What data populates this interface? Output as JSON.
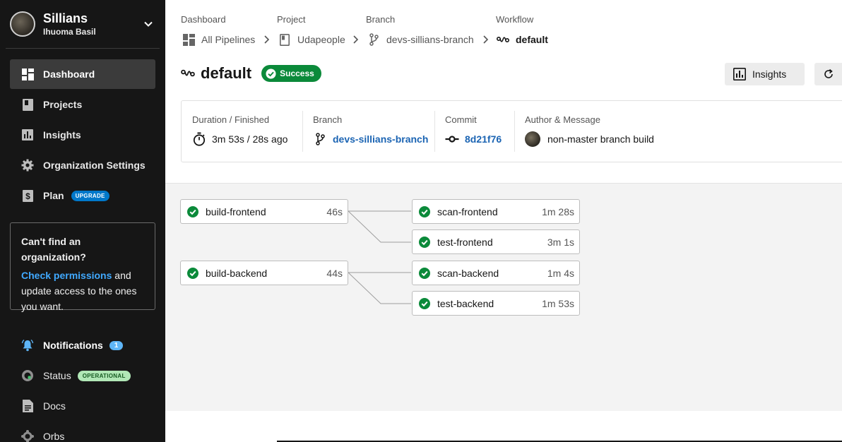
{
  "sidebar": {
    "org_name": "Sillians",
    "user_name": "Ihuoma Basil",
    "nav": [
      {
        "label": "Dashboard",
        "icon": "dashboard-icon",
        "active": true
      },
      {
        "label": "Projects",
        "icon": "projects-icon"
      },
      {
        "label": "Insights",
        "icon": "insights-icon"
      },
      {
        "label": "Organization Settings",
        "icon": "gear-icon"
      },
      {
        "label": "Plan",
        "icon": "plan-icon",
        "badge": "UPGRADE"
      }
    ],
    "org_box": {
      "title": "Can't find an organization?",
      "link": "Check permissions",
      "text_after_link": " and update access to the ones you want."
    },
    "notifications": {
      "label": "Notifications",
      "count": "1"
    },
    "status": {
      "label": "Status",
      "badge": "OPERATIONAL"
    },
    "docs": {
      "label": "Docs"
    },
    "orbs": {
      "label": "Orbs"
    }
  },
  "breadcrumb": [
    {
      "label": "Dashboard",
      "value": "All Pipelines",
      "icon": "pipelines-icon"
    },
    {
      "label": "Project",
      "value": "Udapeople",
      "icon": "project-icon"
    },
    {
      "label": "Branch",
      "value": "devs-sillians-branch",
      "icon": "branch-icon"
    },
    {
      "label": "Workflow",
      "value": "default",
      "icon": "workflow-icon"
    }
  ],
  "workflow": {
    "title": "default",
    "status": "Success",
    "insights_button": "Insights"
  },
  "info": {
    "duration_label": "Duration / Finished",
    "duration_value": "3m 53s / 28s ago",
    "branch_label": "Branch",
    "branch_value": "devs-sillians-branch",
    "commit_label": "Commit",
    "commit_value": "8d21f76",
    "author_label": "Author & Message",
    "author_message": "non-master branch build"
  },
  "jobs": [
    {
      "name": "build-frontend",
      "duration": "46s",
      "status": "success"
    },
    {
      "name": "scan-frontend",
      "duration": "1m 28s",
      "status": "success"
    },
    {
      "name": "test-frontend",
      "duration": "3m 1s",
      "status": "success"
    },
    {
      "name": "build-backend",
      "duration": "44s",
      "status": "success"
    },
    {
      "name": "scan-backend",
      "duration": "1m 4s",
      "status": "success"
    },
    {
      "name": "test-backend",
      "duration": "1m 53s",
      "status": "success"
    }
  ],
  "colors": {
    "sidebar_bg": "#161616",
    "success": "#0b8a3a",
    "link": "#1b64b3",
    "upgrade": "#0078ca"
  }
}
